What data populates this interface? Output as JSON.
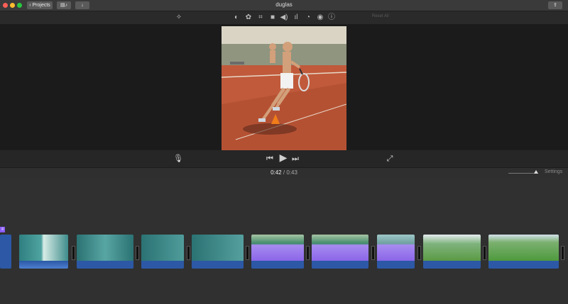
{
  "window": {
    "title": "duglas"
  },
  "titlebar": {
    "projects_label": "Projects",
    "library_icon": "library-icon",
    "import_icon": "download-arrow-icon",
    "share_icon": "share-icon"
  },
  "toolbar": {
    "reset_label": "Reset All",
    "tools": [
      "magic-wand-icon",
      "color-balance-icon",
      "color-palette-icon",
      "crop-icon",
      "camera-stabilize-icon",
      "volume-icon",
      "equalizer-icon",
      "speed-icon",
      "noise-reduction-icon",
      "info-icon"
    ]
  },
  "controls": {
    "mic_icon": "microphone-icon",
    "prev_icon": "skip-back-icon",
    "play_icon": "play-icon",
    "next_icon": "skip-forward-icon",
    "fullscreen_icon": "fullscreen-icon"
  },
  "timeline": {
    "current_time": "0:42",
    "separator": "/",
    "total_time": "0:43",
    "settings_label": "Settings",
    "zoom_level": 0.85
  },
  "clips": [
    {
      "kind": "tennis-court-teal"
    },
    {
      "kind": "tennis-court-teal"
    },
    {
      "kind": "tennis-court-teal"
    },
    {
      "kind": "tennis-court-teal"
    },
    {
      "kind": "tennis-court-teal"
    },
    {
      "kind": "field-purple"
    },
    {
      "kind": "field-purple"
    },
    {
      "kind": "field-purple"
    },
    {
      "kind": "grass-field"
    },
    {
      "kind": "grass-field"
    }
  ],
  "colors": {
    "accent_purple": "#8b5cf6",
    "audio_blue": "#2c58a6",
    "clay": "#c05a3b"
  }
}
